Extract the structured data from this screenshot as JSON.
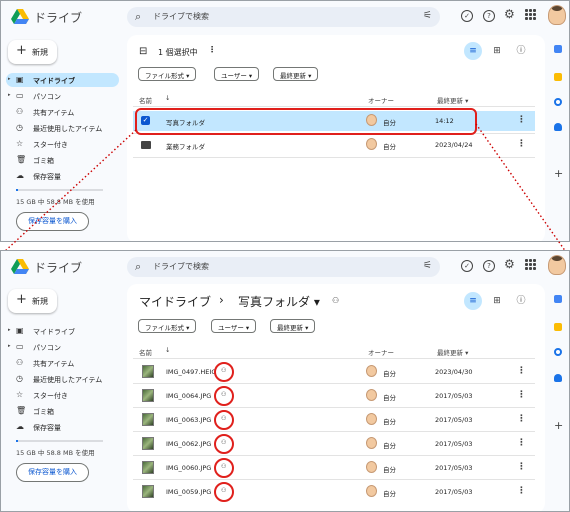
{
  "app": {
    "logo_text": "ドライブ"
  },
  "search": {
    "placeholder": "ドライブで検索"
  },
  "sidebar": {
    "new_label": "新規",
    "items": [
      {
        "label": "マイドライブ"
      },
      {
        "label": "パソコン"
      },
      {
        "label": "共有アイテム"
      },
      {
        "label": "最近使用したアイテム"
      },
      {
        "label": "スター付き"
      },
      {
        "label": "ゴミ箱"
      },
      {
        "label": "保存容量"
      }
    ],
    "quota_text": "15 GB 中 58.8 MB を使用",
    "quota_fraction": 0.004,
    "buy_label": "保存容量を購入"
  },
  "top": {
    "selection_text": "1 個選択中",
    "filters": [
      "ファイル形式 ▾",
      "ユーザー ▾",
      "最終更新 ▾"
    ],
    "columns": {
      "name": "名前",
      "owner": "オーナー",
      "modified": "最終更新 ▾"
    },
    "rows": [
      {
        "name": "写真フォルダ",
        "owner": "自分",
        "modified": "14:12"
      },
      {
        "name": "業務フォルダ",
        "owner": "自分",
        "modified": "2023/04/24"
      }
    ]
  },
  "bottom": {
    "breadcrumb_root": "マイドライブ",
    "breadcrumb_sep": "›",
    "breadcrumb_current": "写真フォルダ ▾",
    "filters": [
      "ファイル形式 ▾",
      "ユーザー ▾",
      "最終更新 ▾"
    ],
    "columns": {
      "name": "名前",
      "owner": "オーナー",
      "modified": "最終更新 ▾"
    },
    "rows": [
      {
        "name": "IMG_0497.HEIC",
        "owner": "自分",
        "modified": "2023/04/30"
      },
      {
        "name": "IMG_0064.JPG",
        "owner": "自分",
        "modified": "2017/05/03"
      },
      {
        "name": "IMG_0063.JPG",
        "owner": "自分",
        "modified": "2017/05/03"
      },
      {
        "name": "IMG_0062.JPG",
        "owner": "自分",
        "modified": "2017/05/03"
      },
      {
        "name": "IMG_0060.JPG",
        "owner": "自分",
        "modified": "2017/05/03"
      },
      {
        "name": "IMG_0059.JPG",
        "owner": "自分",
        "modified": "2017/05/03"
      }
    ]
  },
  "colors": {
    "accent": "#0b57d0",
    "selected_bg": "#c2e7ff",
    "annotation": "#e0201c"
  },
  "icons": {
    "search": "search-icon",
    "filter": "tune-icon",
    "shared": "people-icon",
    "more": "more-vert-icon"
  }
}
